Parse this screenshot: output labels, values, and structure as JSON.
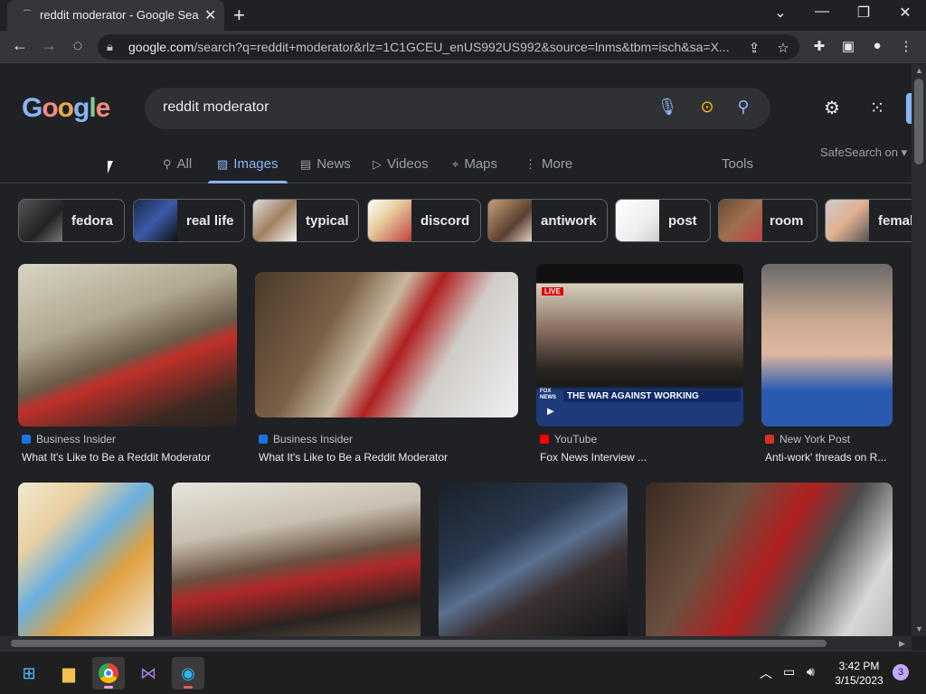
{
  "browser": {
    "tab_title": "reddit moderator - Google Search",
    "url_host": "google.com",
    "url_path": "/search?q=reddit+moderator&rlz=1C1GCEU_enUS992US992&source=lnms&tbm=isch&sa=X..."
  },
  "google": {
    "logo": "Google",
    "query": "reddit moderator",
    "tabs": [
      {
        "label": "All",
        "icon": "search-icon"
      },
      {
        "label": "Images",
        "icon": "image-icon"
      },
      {
        "label": "News",
        "icon": "news-icon"
      },
      {
        "label": "Videos",
        "icon": "play-icon"
      },
      {
        "label": "Maps",
        "icon": "pin-icon"
      },
      {
        "label": "More",
        "icon": "kebab-icon"
      }
    ],
    "tools": "Tools",
    "safesearch": "SafeSearch on"
  },
  "chips": [
    "fedora",
    "real life",
    "typical",
    "discord",
    "antiwork",
    "post",
    "room",
    "femal"
  ],
  "results": [
    {
      "source": "Business Insider",
      "caption": "What It's Like to Be a Reddit Moderator",
      "color": "#1a73e8"
    },
    {
      "source": "Business Insider",
      "caption": "What It's Like to Be a Reddit Moderator",
      "color": "#1a73e8"
    },
    {
      "source": "YouTube",
      "caption": "Fox News Interview ...",
      "color": "#ff0000"
    },
    {
      "source": "New York Post",
      "caption": "Anti-work' threads on R...",
      "color": "#d93025"
    }
  ],
  "video_overlay": {
    "live": "LIVE",
    "banner": "THE WAR AGAINST WORKING",
    "network": "FOX NEWS"
  },
  "taskbar": {
    "time": "3:42 PM",
    "date": "3/15/2023",
    "notifications": "3"
  },
  "colors": {
    "accent": "#8ab4f8",
    "background": "#202124"
  }
}
